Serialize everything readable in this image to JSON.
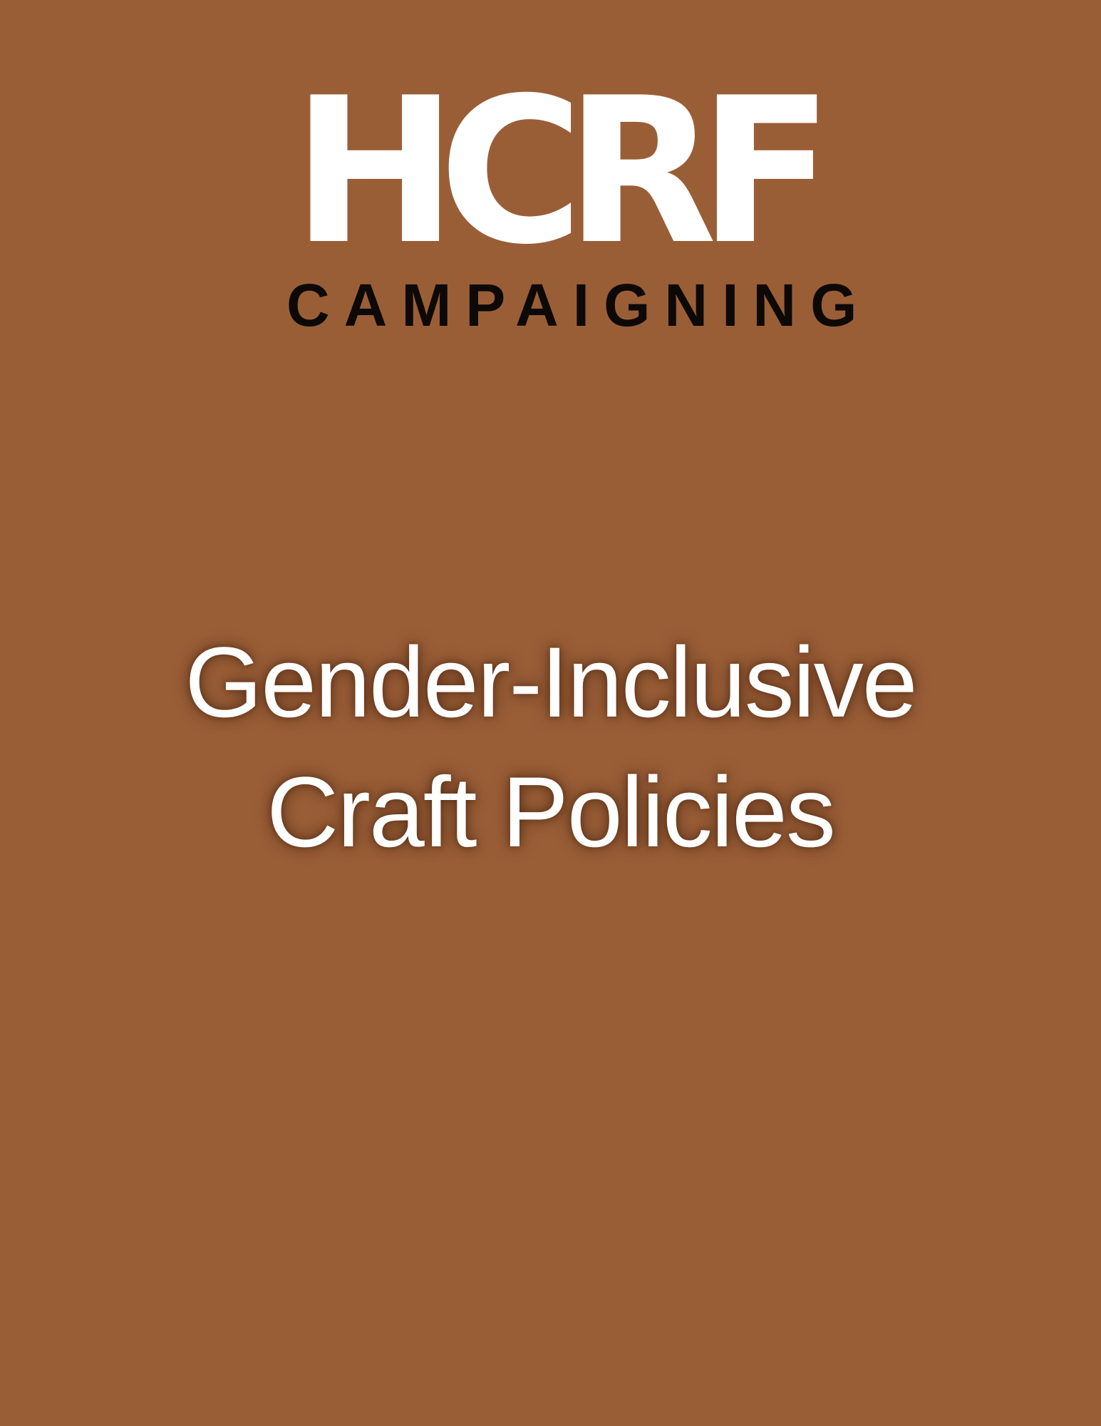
{
  "logo": {
    "mark": "HCRF",
    "subtitle": "CAMPAIGNING"
  },
  "title": {
    "line1": "Gender-Inclusive",
    "line2": "Craft Policies"
  },
  "colors": {
    "background": "#9a5e37",
    "logo_mark": "#ffffff",
    "logo_subtitle": "#0d0906",
    "title_text": "#ffffff"
  }
}
